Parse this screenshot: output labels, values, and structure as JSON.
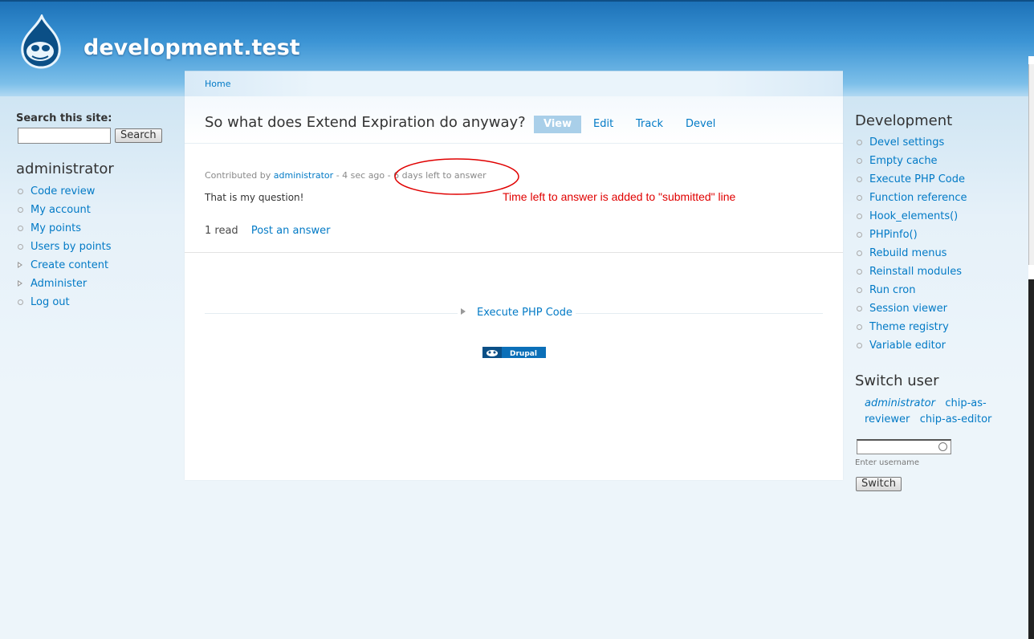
{
  "site": {
    "name": "development.test"
  },
  "breadcrumb": {
    "home": "Home"
  },
  "search": {
    "title": "Search this site:",
    "value": "",
    "button": "Search"
  },
  "user_block": {
    "title": "administrator",
    "items": [
      {
        "label": "Code review",
        "marker": "circle"
      },
      {
        "label": "My account",
        "marker": "circle"
      },
      {
        "label": "My points",
        "marker": "circle"
      },
      {
        "label": "Users by points",
        "marker": "circle"
      },
      {
        "label": "Create content",
        "marker": "triangle"
      },
      {
        "label": "Administer",
        "marker": "triangle"
      },
      {
        "label": "Log out",
        "marker": "circle"
      }
    ]
  },
  "node": {
    "title": "So what does Extend Expiration do anyway?",
    "tabs": [
      "View",
      "Edit",
      "Track",
      "Devel"
    ],
    "submitted": {
      "prefix": "Contributed by",
      "author": "administrator",
      "time": "- 4 sec ago -",
      "left": "6 days left to answer"
    },
    "body": "That is my question!",
    "reads": "1 read",
    "post_answer": "Post an answer"
  },
  "footer": {
    "link": "Execute PHP Code",
    "powered": "Drupal"
  },
  "annotation": {
    "text": "Time left to answer is added to \"submitted\" line",
    "color": "#e00000"
  },
  "devel_block": {
    "title": "Development",
    "items": [
      "Devel settings",
      "Empty cache",
      "Execute PHP Code",
      "Function reference",
      "Hook_elements()",
      "PHPinfo()",
      "Rebuild menus",
      "Reinstall modules",
      "Run cron",
      "Session viewer",
      "Theme registry",
      "Variable editor"
    ]
  },
  "switch_user": {
    "title": "Switch user",
    "current": "administrator",
    "users": [
      "chip-as-reviewer",
      "chip-as-editor"
    ],
    "input_value": "",
    "hint": "Enter username",
    "button": "Switch"
  },
  "colors": {
    "link": "#027ac6",
    "header": "#2b83c9"
  }
}
